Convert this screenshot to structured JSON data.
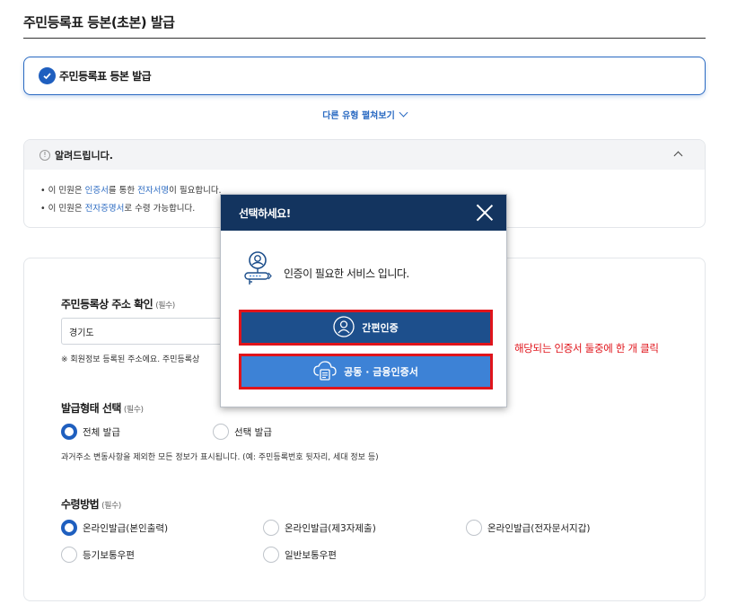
{
  "page": {
    "title": "주민등록표 등본(초본) 발급"
  },
  "selected_type": {
    "label": "주민등록표 등본 발급"
  },
  "expand_link": {
    "label": "다른 유형 펼쳐보기"
  },
  "notice": {
    "icon": "!",
    "title": "알려드립니다.",
    "lines": [
      {
        "prefix": "• 이 민원은 ",
        "hl1": "인증서",
        "mid": "를 통한 ",
        "hl2": "전자서명",
        "suffix": "이 필요합니다."
      },
      {
        "prefix": "• 이 민원은 ",
        "hl1": "전자증명서",
        "mid": "로 수령 가능합니다.",
        "hl2": "",
        "suffix": ""
      }
    ]
  },
  "form": {
    "address": {
      "title": "주민등록상 주소 확인",
      "required": "(필수)",
      "value": "경기도",
      "note": "※ 회원정보 등록된 주소에요. 주민등록상"
    },
    "issue_type": {
      "title": "발급형태 선택",
      "required": "(필수)",
      "options": [
        {
          "label": "전체 발급",
          "checked": true
        },
        {
          "label": "선택 발급",
          "checked": false
        }
      ],
      "help": "과거주소 변동사항을 제외한 모든 정보가 표시됩니다. (예: 주민등록번호 뒷자리, 세대 정보 등)"
    },
    "receive_method": {
      "title": "수령방법",
      "required": "(필수)",
      "options": [
        {
          "label": "온라인발급(본인출력)",
          "checked": true
        },
        {
          "label": "온라인발급(제3자제출)",
          "checked": false
        },
        {
          "label": "온라인발급(전자문서지갑)",
          "checked": false
        },
        {
          "label": "등기보통우편",
          "checked": false
        },
        {
          "label": "일반보통우편",
          "checked": false
        }
      ]
    }
  },
  "modal": {
    "title": "선택하세요!",
    "message": "인증이 필요한 서비스 입니다.",
    "buttons": {
      "simple": "간편인증",
      "cert": "공동 · 금융인증서"
    }
  },
  "hint": "해당되는 인증서 둘중에 한 개 클릭",
  "colors": {
    "primary": "#1f5fbf",
    "modal_header": "#13345f",
    "highlight_border": "#e0141b"
  }
}
